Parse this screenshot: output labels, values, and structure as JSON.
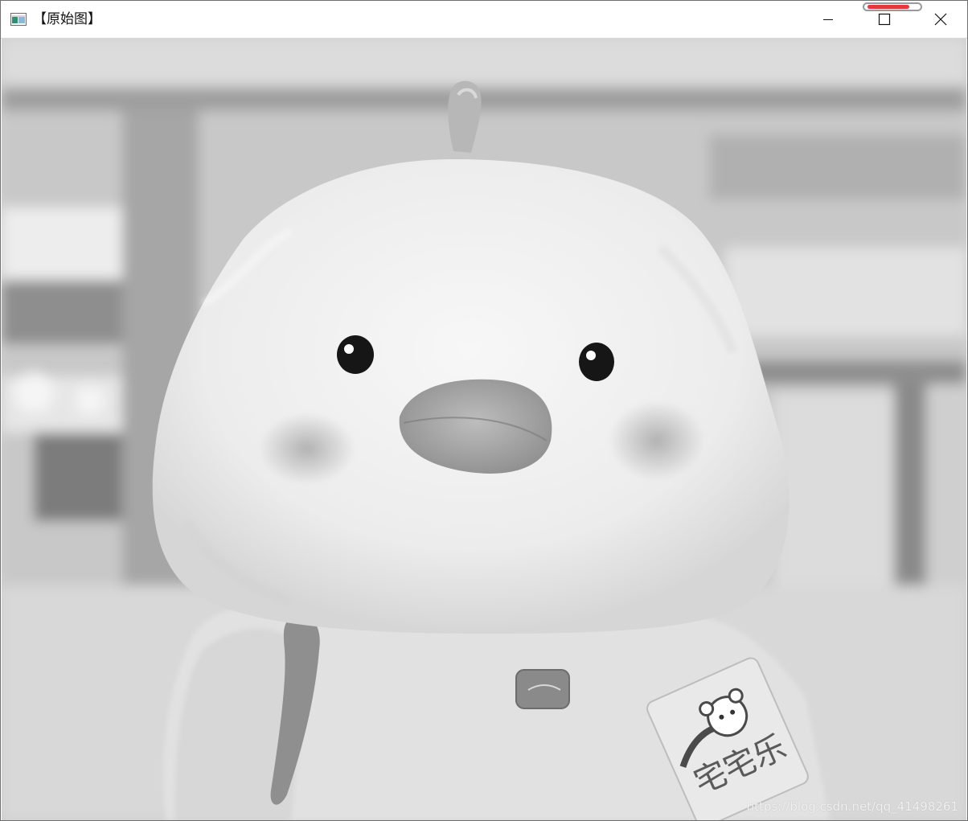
{
  "window": {
    "title": "【原始图】",
    "controls": {
      "minimize_icon": "minimize-icon",
      "maximize_icon": "maximize-icon",
      "close_icon": "close-icon"
    },
    "highlight_color": "#e23a3a"
  },
  "image": {
    "mode": "grayscale",
    "watermark": "https://blog.csdn.net/qq_41498261",
    "tag_text": "宅宅乐"
  }
}
